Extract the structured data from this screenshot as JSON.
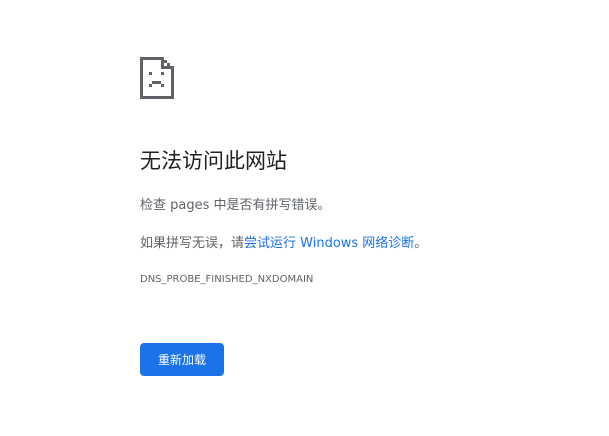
{
  "error_icon": "sad-page-icon",
  "heading": "无法访问此网站",
  "check_line": "检查 pages 中是否有拼写错误。",
  "suggest": {
    "prefix": "如果拼写无误，请",
    "link_text": "尝试运行 Windows 网络诊断",
    "suffix": "。"
  },
  "error_code": "DNS_PROBE_FINISHED_NXDOMAIN",
  "reload_button": "重新加载",
  "colors": {
    "accent": "#1a73e8",
    "heading": "#202124",
    "body_text": "#5f6368"
  }
}
